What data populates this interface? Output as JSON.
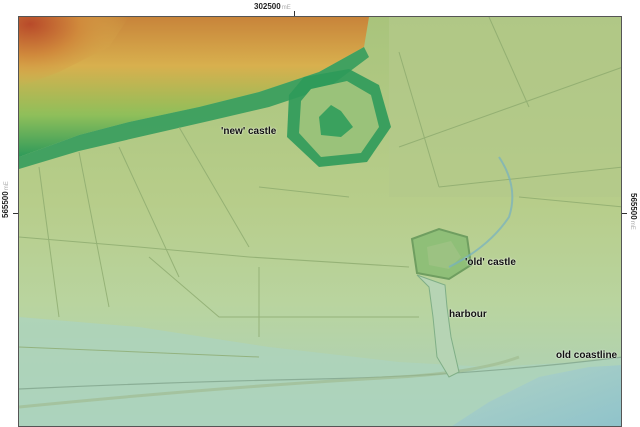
{
  "grid": {
    "easting_top": "302500",
    "northing_left": "565500",
    "northing_right": "565500",
    "suffix": "mE"
  },
  "labels": {
    "new_castle": "'new' castle",
    "old_castle": "'old' castle",
    "harbour": "harbour",
    "old_coastline": "old coastline"
  },
  "colors": {
    "high_ground": "#c25a2c",
    "upland": "#d7a64a",
    "ridge_green": "#2e9a5a",
    "field_green": "#a6c27a",
    "lowland": "#b9d49a",
    "coast": "#a9d0c0",
    "sea": "#9ec9cf"
  }
}
